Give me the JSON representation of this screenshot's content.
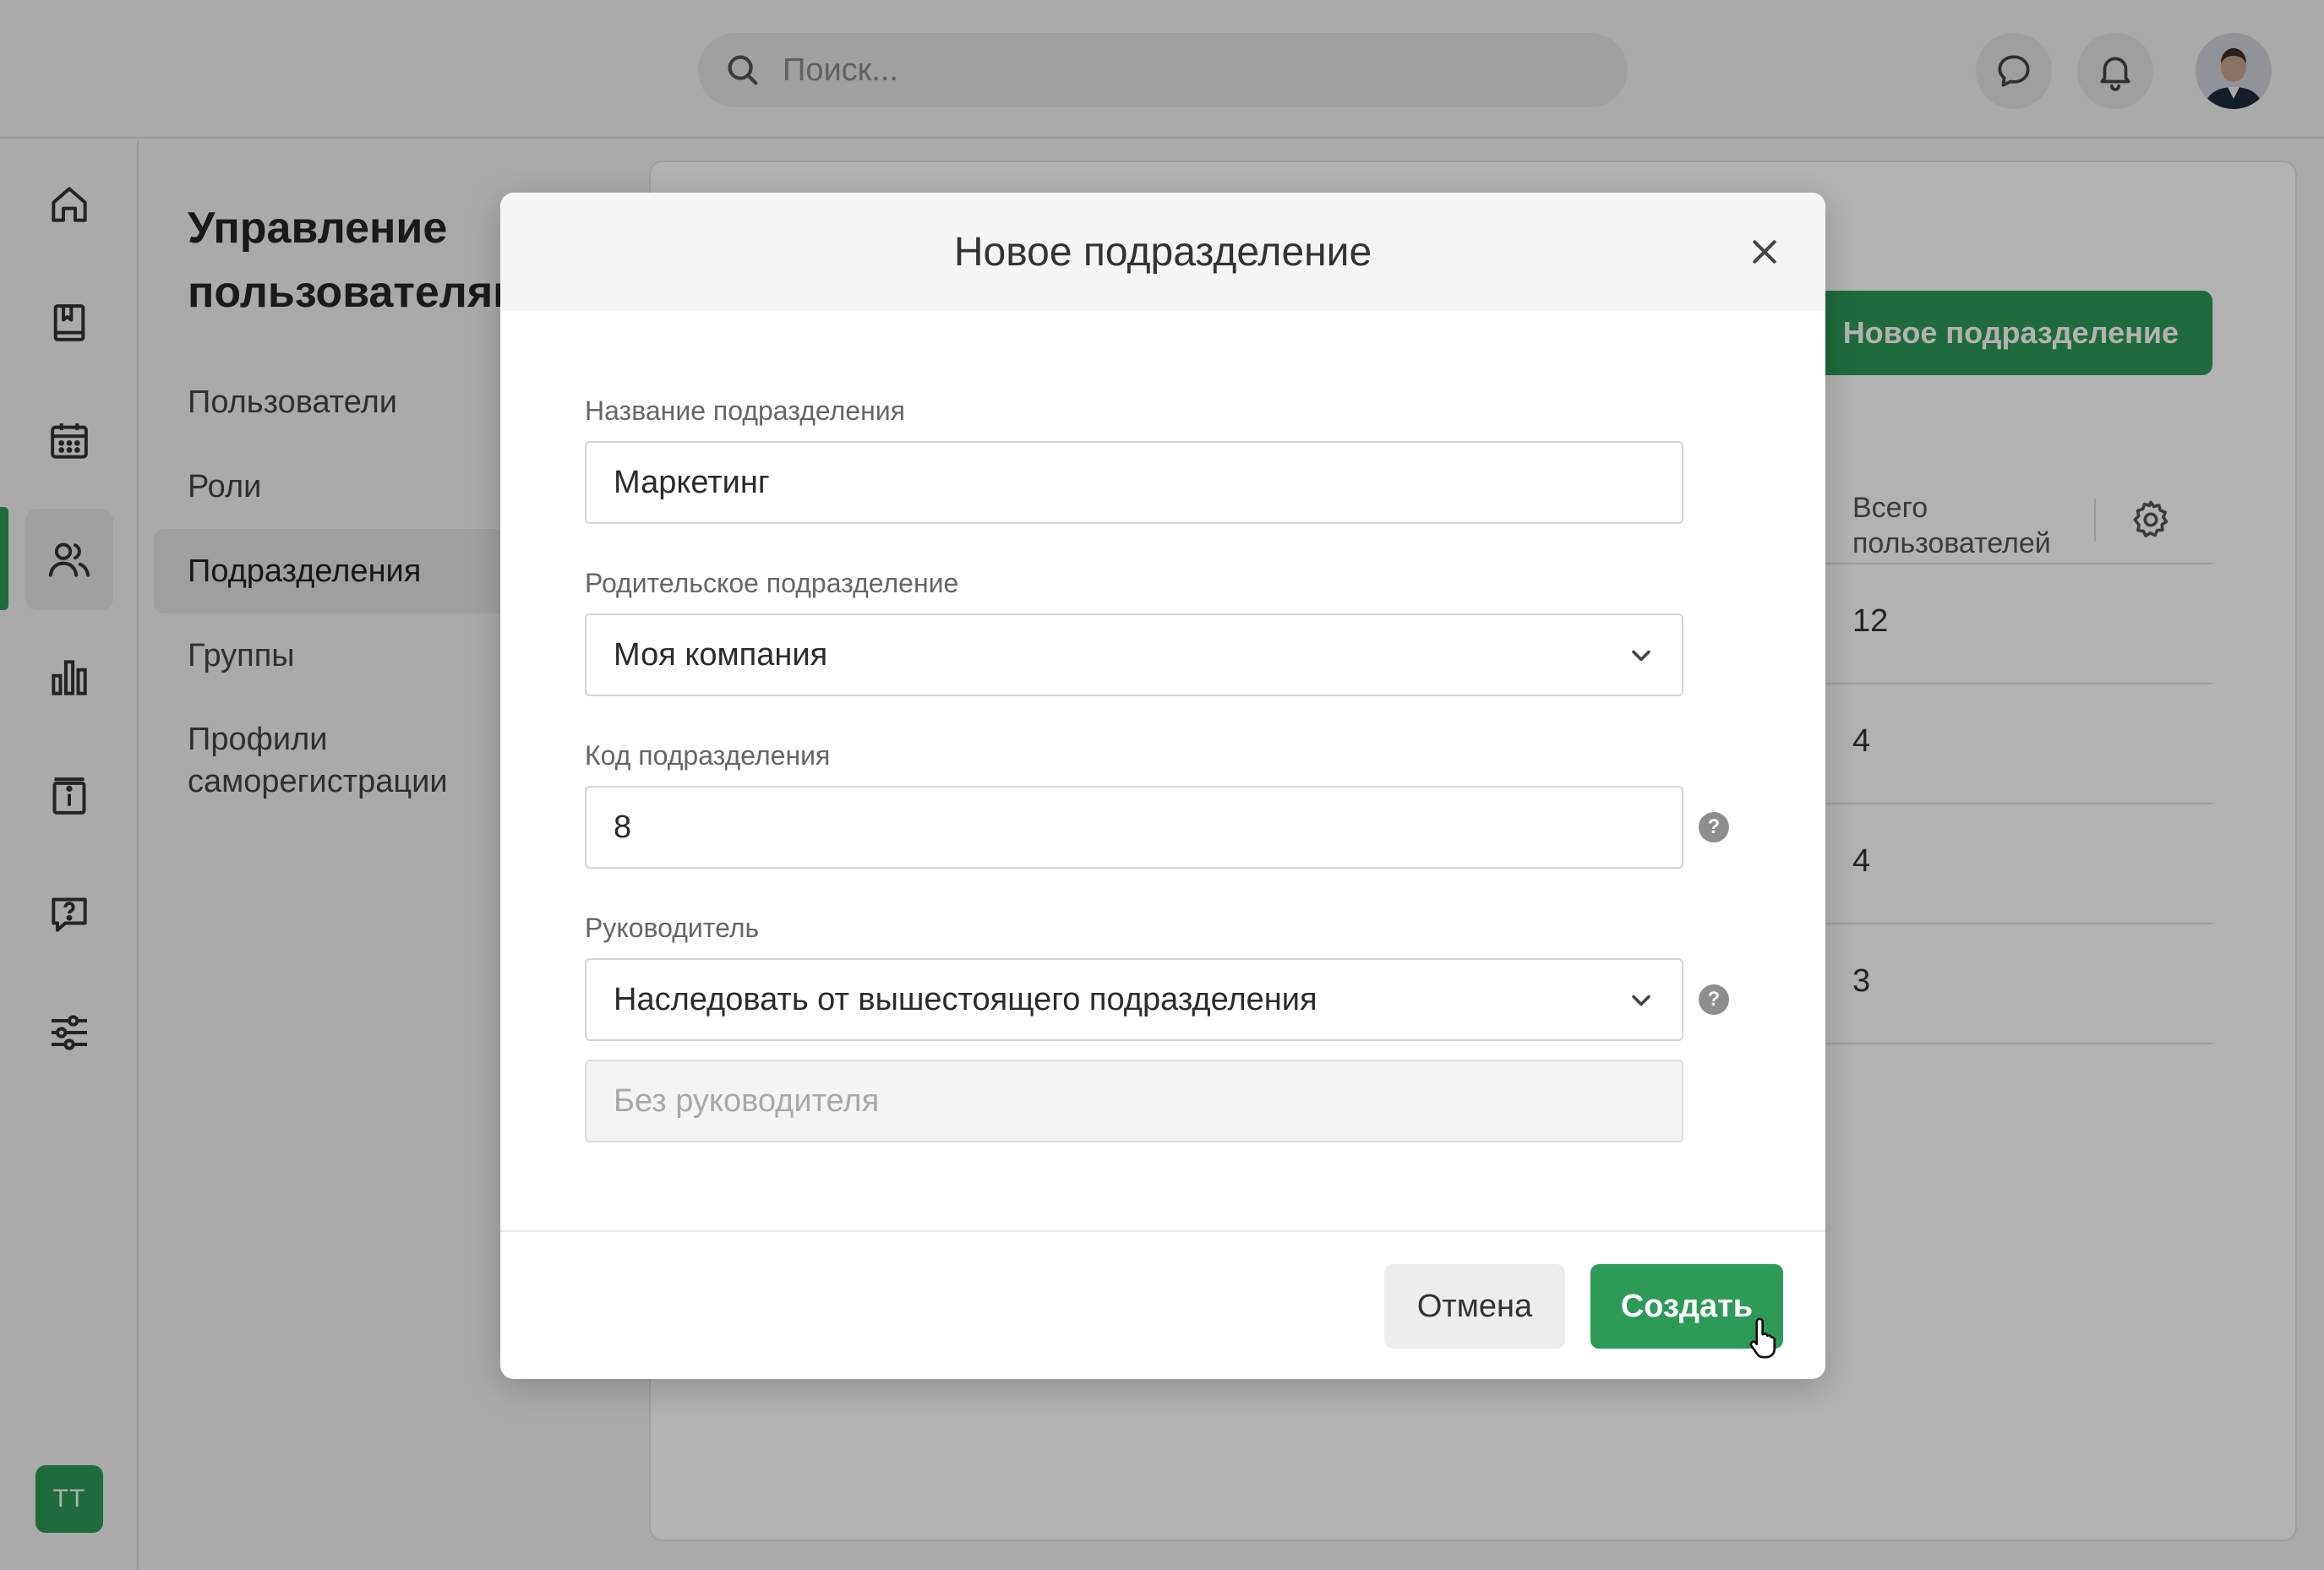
{
  "topbar": {
    "search_placeholder": "Поиск...",
    "chat_icon": "chat-bubble-icon",
    "notifications_icon": "bell-icon"
  },
  "rail": {
    "items": [
      "home-icon",
      "book-icon",
      "calendar-icon",
      "users-icon",
      "bar-chart-icon",
      "info-board-icon",
      "help-chat-icon",
      "sliders-icon"
    ],
    "active": "users-icon",
    "user_initials": "TT"
  },
  "section": {
    "title": "Управление пользователями",
    "nav": [
      {
        "label": "Пользователи"
      },
      {
        "label": "Роли"
      },
      {
        "label": "Подразделения",
        "active": true
      },
      {
        "label": "Группы"
      },
      {
        "label": "Профили саморегистрации"
      }
    ]
  },
  "content": {
    "new_department_button": "Новое подразделение",
    "table_header": "Всего пользователей",
    "rows": [
      "12",
      "4",
      "4",
      "3"
    ]
  },
  "modal": {
    "title": "Новое подразделение",
    "name_label": "Название подразделения",
    "name_value": "Маркетинг",
    "parent_label": "Родительское подразделение",
    "parent_value": "Моя компания",
    "code_label": "Код подразделения",
    "code_value": "8",
    "manager_label": "Руководитель",
    "manager_value": "Наследовать от вышестоящего подразделения",
    "manager_placeholder": "Без руководителя",
    "help_glyph": "?",
    "cancel_label": "Отмена",
    "create_label": "Создать"
  },
  "colors": {
    "accent": "#2d9a57",
    "background": "#f4f4f4",
    "overlay": "rgba(0,0,0,0.30)"
  }
}
